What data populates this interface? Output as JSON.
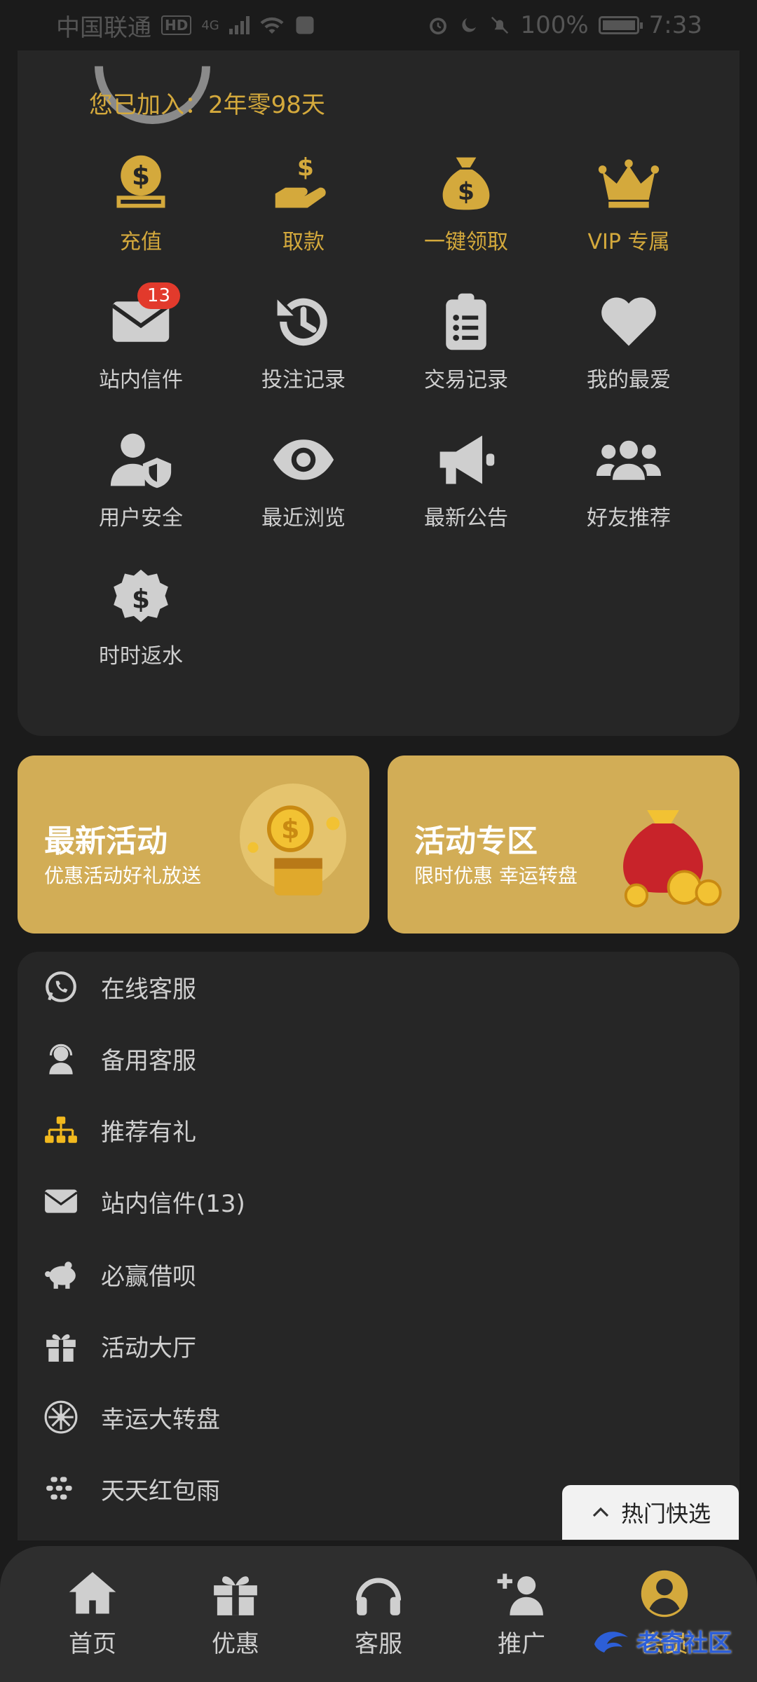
{
  "status_bar": {
    "carrier": "中国联通",
    "hd": "HD",
    "network": "4G",
    "battery": "100%",
    "time": "7:33"
  },
  "profile": {
    "joined_text": "您已加入：2年零98天"
  },
  "grid": [
    {
      "label": "充值",
      "icon": "deposit-coin-icon",
      "gold": true
    },
    {
      "label": "取款",
      "icon": "withdraw-hand-icon",
      "gold": true
    },
    {
      "label": "一键领取",
      "icon": "money-bag-icon",
      "gold": true
    },
    {
      "label": "VIP 专属",
      "icon": "crown-icon",
      "gold": true
    },
    {
      "label": "站内信件",
      "icon": "envelope-icon",
      "badge": "13"
    },
    {
      "label": "投注记录",
      "icon": "history-icon"
    },
    {
      "label": "交易记录",
      "icon": "clipboard-icon"
    },
    {
      "label": "我的最爱",
      "icon": "heart-icon"
    },
    {
      "label": "用户安全",
      "icon": "user-shield-icon"
    },
    {
      "label": "最近浏览",
      "icon": "eye-icon"
    },
    {
      "label": "最新公告",
      "icon": "megaphone-icon"
    },
    {
      "label": "好友推荐",
      "icon": "users-icon"
    },
    {
      "label": "时时返水",
      "icon": "coin-badge-icon"
    }
  ],
  "banners": [
    {
      "title": "最新活动",
      "subtitle": "优惠活动好礼放送",
      "art": "treasure-chest-coins"
    },
    {
      "title": "活动专区",
      "subtitle": "限时优惠 幸运转盘",
      "art": "red-money-bag-coins"
    }
  ],
  "menu": [
    {
      "label": "在线客服",
      "icon": "whatsapp-icon"
    },
    {
      "label": "备用客服",
      "icon": "headset-agent-icon"
    },
    {
      "label": "推荐有礼",
      "icon": "sitemap-icon"
    },
    {
      "label": "站内信件(13)",
      "icon": "envelope-icon"
    },
    {
      "label": "必赢借呗",
      "icon": "piggy-bank-icon"
    },
    {
      "label": "活动大厅",
      "icon": "gift-icon"
    },
    {
      "label": "幸运大转盘",
      "icon": "wheel-icon"
    },
    {
      "label": "天天红包雨",
      "icon": "rain-dots-icon"
    }
  ],
  "hot_pick": {
    "label": "热门快选"
  },
  "bottom_nav": [
    {
      "label": "首页",
      "icon": "home-icon"
    },
    {
      "label": "优惠",
      "icon": "gift-icon"
    },
    {
      "label": "客服",
      "icon": "headphones-icon"
    },
    {
      "label": "推广",
      "icon": "user-plus-icon"
    },
    {
      "label": "会员",
      "icon": "user-circle-icon",
      "active": true
    }
  ],
  "watermark": {
    "text": "老奇社区"
  },
  "colors": {
    "accent": "#d4a93c",
    "background": "#1b1b1b",
    "card": "#262626",
    "badge": "#e23a2c"
  }
}
